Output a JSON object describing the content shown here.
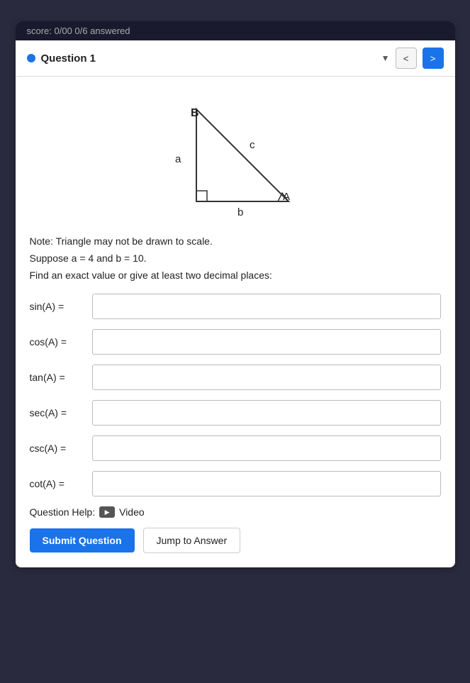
{
  "score_bar": {
    "text": "score: 0/00   0/6 answered"
  },
  "header": {
    "question_label": "Question 1",
    "dropdown_symbol": "▼",
    "nav_prev": "<",
    "nav_next": ">"
  },
  "triangle": {
    "label_a": "a",
    "label_b": "b",
    "label_c": "c",
    "label_A": "A",
    "label_B": "B"
  },
  "note": "Note: Triangle may not be drawn to scale.",
  "suppose": "Suppose a = 4 and b = 10.",
  "find": "Find an exact value or give at least two decimal places:",
  "inputs": [
    {
      "label": "sin(A) =",
      "id": "sin-a",
      "placeholder": ""
    },
    {
      "label": "cos(A) =",
      "id": "cos-a",
      "placeholder": ""
    },
    {
      "label": "tan(A) =",
      "id": "tan-a",
      "placeholder": ""
    },
    {
      "label": "sec(A) =",
      "id": "sec-a",
      "placeholder": ""
    },
    {
      "label": "csc(A) =",
      "id": "csc-a",
      "placeholder": ""
    },
    {
      "label": "cot(A) =",
      "id": "cot-a",
      "placeholder": ""
    }
  ],
  "question_help_label": "Question Help:",
  "video_label": "Video",
  "submit_label": "Submit Question",
  "jump_label": "Jump to Answer"
}
